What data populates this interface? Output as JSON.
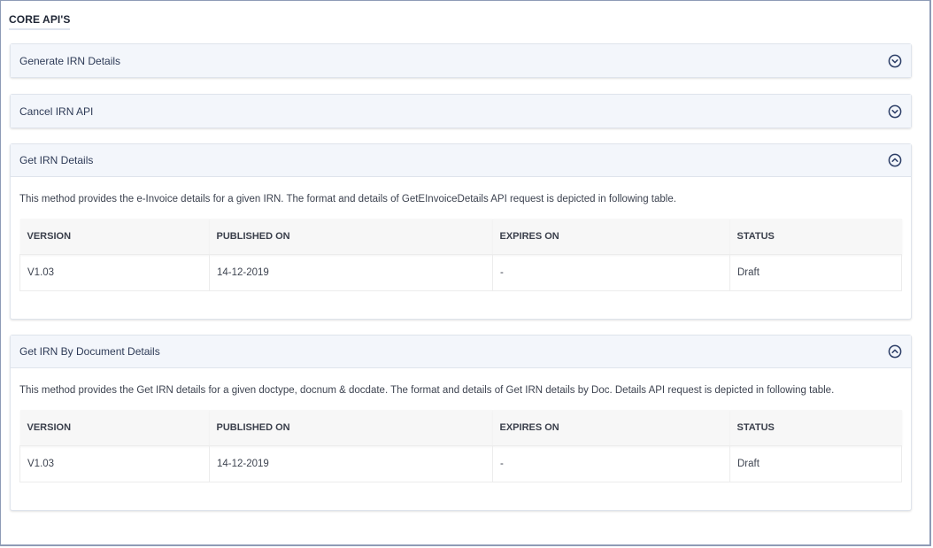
{
  "section_title": "CORE API'S",
  "panels": [
    {
      "title": "Generate IRN Details",
      "expanded": false
    },
    {
      "title": "Cancel IRN API",
      "expanded": false
    },
    {
      "title": "Get IRN Details",
      "expanded": true,
      "description": "This method provides the e-Invoice details for a given IRN. The format and details of GetEInvoiceDetails API request is depicted in following table.",
      "table": {
        "headers": [
          "VERSION",
          "PUBLISHED ON",
          "EXPIRES ON",
          "STATUS"
        ],
        "rows": [
          [
            "V1.03",
            "14-12-2019",
            "-",
            "Draft"
          ]
        ]
      }
    },
    {
      "title": "Get IRN By Document Details",
      "expanded": true,
      "description": "This method provides the Get IRN details for a given doctype, docnum & docdate. The format and details of Get IRN details by Doc. Details API request is depicted in following table.",
      "table": {
        "headers": [
          "VERSION",
          "PUBLISHED ON",
          "EXPIRES ON",
          "STATUS"
        ],
        "rows": [
          [
            "V1.03",
            "14-12-2019",
            "-",
            "Draft"
          ]
        ]
      }
    }
  ],
  "icons": {
    "collapsed": "chevron-down-circle-icon",
    "expanded": "chevron-up-circle-icon"
  },
  "colors": {
    "header_bg": "#f3f6fb",
    "title_text": "#2e3b57",
    "link": "#2b4a86",
    "icon": "#2b3d66"
  }
}
